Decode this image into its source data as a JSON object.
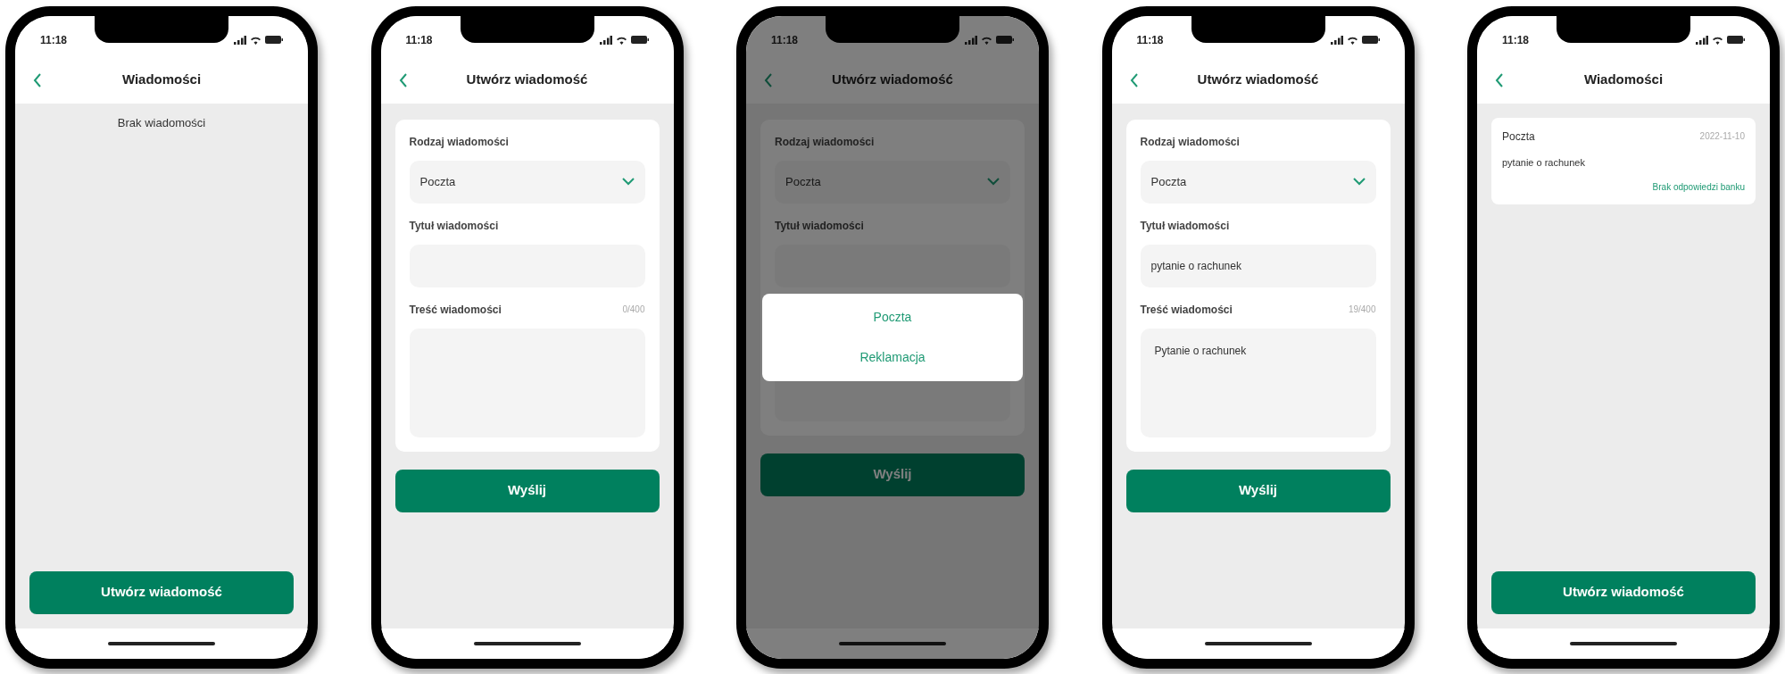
{
  "phones": [
    {
      "kind": "empty",
      "time": "11:18",
      "title": "Wiadomości",
      "empty_text": "Brak wiadomości",
      "button": "Utwórz wiadomość"
    },
    {
      "kind": "form",
      "time": "11:18",
      "title": "Utwórz wiadomość",
      "type_label": "Rodzaj wiadomości",
      "type_value": "Poczta",
      "title_label": "Tytuł wiadomości",
      "body_label": "Treść wiadomości",
      "counter": "0/400",
      "button": "Wyślij"
    },
    {
      "kind": "form",
      "time": "11:18",
      "title": "Utwórz wiadomość",
      "type_label": "Rodzaj wiadomości",
      "type_value": "Poczta",
      "title_label": "Tytuł wiadomości",
      "button": "Wyślij",
      "dialog": {
        "options": [
          "Poczta",
          "Reklamacja"
        ]
      }
    },
    {
      "kind": "form",
      "time": "11:18",
      "title": "Utwórz wiadomość",
      "type_label": "Rodzaj wiadomości",
      "type_value": "Poczta",
      "title_label": "Tytuł wiadomości",
      "title_value": "pytanie o rachunek",
      "body_label": "Treść wiadomości",
      "counter": "19/400",
      "body_value": "Pytanie o rachunek",
      "button": "Wyślij"
    },
    {
      "kind": "list",
      "time": "11:18",
      "title": "Wiadomości",
      "messages": [
        {
          "type": "Poczta",
          "date": "2022-11-10",
          "subject": "pytanie o rachunek",
          "status": "Brak odpowiedzi banku"
        }
      ],
      "button": "Utwórz wiadomość"
    }
  ]
}
